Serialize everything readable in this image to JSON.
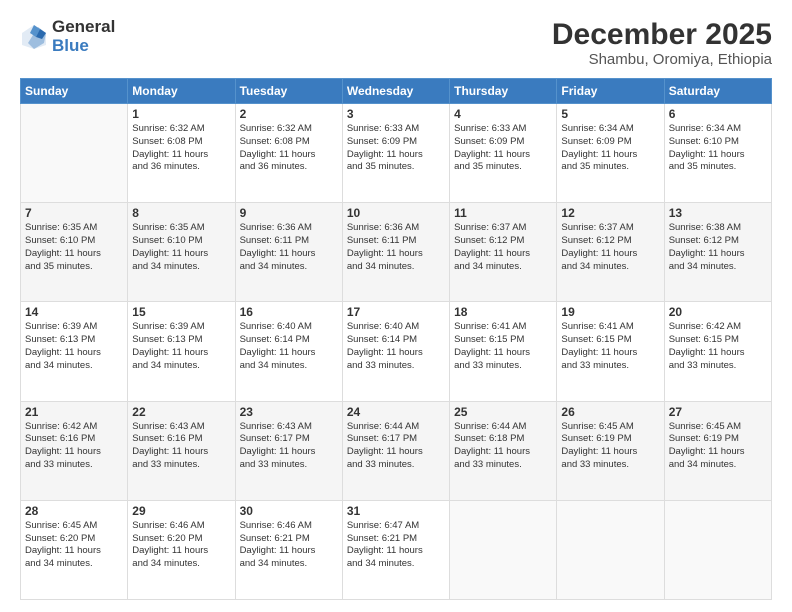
{
  "logo": {
    "general": "General",
    "blue": "Blue"
  },
  "header": {
    "month": "December 2025",
    "location": "Shambu, Oromiya, Ethiopia"
  },
  "days": [
    "Sunday",
    "Monday",
    "Tuesday",
    "Wednesday",
    "Thursday",
    "Friday",
    "Saturday"
  ],
  "weeks": [
    [
      {
        "day": "",
        "info": ""
      },
      {
        "day": "1",
        "info": "Sunrise: 6:32 AM\nSunset: 6:08 PM\nDaylight: 11 hours\nand 36 minutes."
      },
      {
        "day": "2",
        "info": "Sunrise: 6:32 AM\nSunset: 6:08 PM\nDaylight: 11 hours\nand 36 minutes."
      },
      {
        "day": "3",
        "info": "Sunrise: 6:33 AM\nSunset: 6:09 PM\nDaylight: 11 hours\nand 35 minutes."
      },
      {
        "day": "4",
        "info": "Sunrise: 6:33 AM\nSunset: 6:09 PM\nDaylight: 11 hours\nand 35 minutes."
      },
      {
        "day": "5",
        "info": "Sunrise: 6:34 AM\nSunset: 6:09 PM\nDaylight: 11 hours\nand 35 minutes."
      },
      {
        "day": "6",
        "info": "Sunrise: 6:34 AM\nSunset: 6:10 PM\nDaylight: 11 hours\nand 35 minutes."
      }
    ],
    [
      {
        "day": "7",
        "info": "Sunrise: 6:35 AM\nSunset: 6:10 PM\nDaylight: 11 hours\nand 35 minutes."
      },
      {
        "day": "8",
        "info": "Sunrise: 6:35 AM\nSunset: 6:10 PM\nDaylight: 11 hours\nand 34 minutes."
      },
      {
        "day": "9",
        "info": "Sunrise: 6:36 AM\nSunset: 6:11 PM\nDaylight: 11 hours\nand 34 minutes."
      },
      {
        "day": "10",
        "info": "Sunrise: 6:36 AM\nSunset: 6:11 PM\nDaylight: 11 hours\nand 34 minutes."
      },
      {
        "day": "11",
        "info": "Sunrise: 6:37 AM\nSunset: 6:12 PM\nDaylight: 11 hours\nand 34 minutes."
      },
      {
        "day": "12",
        "info": "Sunrise: 6:37 AM\nSunset: 6:12 PM\nDaylight: 11 hours\nand 34 minutes."
      },
      {
        "day": "13",
        "info": "Sunrise: 6:38 AM\nSunset: 6:12 PM\nDaylight: 11 hours\nand 34 minutes."
      }
    ],
    [
      {
        "day": "14",
        "info": "Sunrise: 6:39 AM\nSunset: 6:13 PM\nDaylight: 11 hours\nand 34 minutes."
      },
      {
        "day": "15",
        "info": "Sunrise: 6:39 AM\nSunset: 6:13 PM\nDaylight: 11 hours\nand 34 minutes."
      },
      {
        "day": "16",
        "info": "Sunrise: 6:40 AM\nSunset: 6:14 PM\nDaylight: 11 hours\nand 34 minutes."
      },
      {
        "day": "17",
        "info": "Sunrise: 6:40 AM\nSunset: 6:14 PM\nDaylight: 11 hours\nand 33 minutes."
      },
      {
        "day": "18",
        "info": "Sunrise: 6:41 AM\nSunset: 6:15 PM\nDaylight: 11 hours\nand 33 minutes."
      },
      {
        "day": "19",
        "info": "Sunrise: 6:41 AM\nSunset: 6:15 PM\nDaylight: 11 hours\nand 33 minutes."
      },
      {
        "day": "20",
        "info": "Sunrise: 6:42 AM\nSunset: 6:15 PM\nDaylight: 11 hours\nand 33 minutes."
      }
    ],
    [
      {
        "day": "21",
        "info": "Sunrise: 6:42 AM\nSunset: 6:16 PM\nDaylight: 11 hours\nand 33 minutes."
      },
      {
        "day": "22",
        "info": "Sunrise: 6:43 AM\nSunset: 6:16 PM\nDaylight: 11 hours\nand 33 minutes."
      },
      {
        "day": "23",
        "info": "Sunrise: 6:43 AM\nSunset: 6:17 PM\nDaylight: 11 hours\nand 33 minutes."
      },
      {
        "day": "24",
        "info": "Sunrise: 6:44 AM\nSunset: 6:17 PM\nDaylight: 11 hours\nand 33 minutes."
      },
      {
        "day": "25",
        "info": "Sunrise: 6:44 AM\nSunset: 6:18 PM\nDaylight: 11 hours\nand 33 minutes."
      },
      {
        "day": "26",
        "info": "Sunrise: 6:45 AM\nSunset: 6:19 PM\nDaylight: 11 hours\nand 33 minutes."
      },
      {
        "day": "27",
        "info": "Sunrise: 6:45 AM\nSunset: 6:19 PM\nDaylight: 11 hours\nand 34 minutes."
      }
    ],
    [
      {
        "day": "28",
        "info": "Sunrise: 6:45 AM\nSunset: 6:20 PM\nDaylight: 11 hours\nand 34 minutes."
      },
      {
        "day": "29",
        "info": "Sunrise: 6:46 AM\nSunset: 6:20 PM\nDaylight: 11 hours\nand 34 minutes."
      },
      {
        "day": "30",
        "info": "Sunrise: 6:46 AM\nSunset: 6:21 PM\nDaylight: 11 hours\nand 34 minutes."
      },
      {
        "day": "31",
        "info": "Sunrise: 6:47 AM\nSunset: 6:21 PM\nDaylight: 11 hours\nand 34 minutes."
      },
      {
        "day": "",
        "info": ""
      },
      {
        "day": "",
        "info": ""
      },
      {
        "day": "",
        "info": ""
      }
    ]
  ]
}
